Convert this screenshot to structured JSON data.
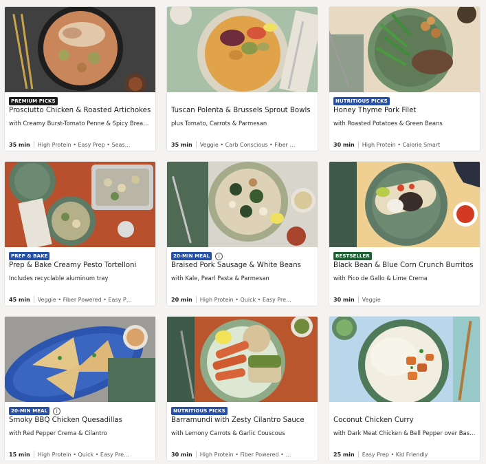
{
  "colors": {
    "badge_dark": "#1c1c1c",
    "badge_blue": "#2650a8",
    "badge_green": "#1f5f34"
  },
  "recipes": [
    {
      "badge": "PREMIUM PICKS",
      "badge_color": "#1c1c1c",
      "info_icon": false,
      "title": "Prosciutto Chicken & Roasted Artichokes",
      "subtitle": "with Creamy Burst-Tomato Penne & Spicy Breadcru…",
      "time": "35 min",
      "tags": "High Protein • Easy Prep • Seas…",
      "photo": "pasta-chicken-dark"
    },
    {
      "badge": "",
      "badge_color": "",
      "info_icon": false,
      "title": "Tuscan Polenta & Brussels Sprout Bowls",
      "subtitle": "plus Tomato, Carrots & Parmesan",
      "time": "35 min",
      "tags": "Veggie • Carb Conscious • Fiber …",
      "photo": "polenta-bowl-green"
    },
    {
      "badge": "NUTRITIOUS PICKS",
      "badge_color": "#2650a8",
      "info_icon": false,
      "title": "Honey Thyme Pork Filet",
      "subtitle": "with Roasted Potatoes & Green Beans",
      "time": "30 min",
      "tags": "High Protein • Calorie Smart",
      "photo": "pork-green-beans"
    },
    {
      "badge": "PREP & BAKE",
      "badge_color": "#2650a8",
      "info_icon": false,
      "title": "Prep & Bake Creamy Pesto Tortelloni",
      "subtitle": "Includes recyclable aluminum tray",
      "time": "45 min",
      "tags": "Veggie • Fiber Powered • Easy P…",
      "photo": "pesto-tortelloni-tray"
    },
    {
      "badge": "20-MIN MEAL",
      "badge_color": "#2650a8",
      "info_icon": true,
      "title": "Braised Pork Sausage & White Beans",
      "subtitle": "with Kale, Pearl Pasta & Parmesan",
      "time": "20 min",
      "tags": "High Protein • Quick • Easy Pre…",
      "photo": "sausage-white-beans"
    },
    {
      "badge": "BESTSELLER",
      "badge_color": "#1f5f34",
      "info_icon": false,
      "title": "Black Bean & Blue Corn Crunch Burritos",
      "subtitle": "with Pico de Gallo & Lime Crema",
      "time": "30 min",
      "tags": "Veggie",
      "photo": "burritos-salsa"
    },
    {
      "badge": "20-MIN MEAL",
      "badge_color": "#2650a8",
      "info_icon": true,
      "title": "Smoky BBQ Chicken Quesadillas",
      "subtitle": "with Red Pepper Crema & Cilantro",
      "time": "15 min",
      "tags": "High Protein • Quick • Easy Pre…",
      "photo": "quesadillas-blue-plate"
    },
    {
      "badge": "NUTRITIOUS PICKS",
      "badge_color": "#2650a8",
      "info_icon": false,
      "title": "Barramundi with Zesty Cilantro Sauce",
      "subtitle": "with Lemony Carrots & Garlic Couscous",
      "time": "30 min",
      "tags": "High Protein • Fiber Powered • …",
      "photo": "barramundi-couscous"
    },
    {
      "badge": "",
      "badge_color": "",
      "info_icon": false,
      "title": "Coconut Chicken Curry",
      "subtitle": "with Dark Meat Chicken & Bell Pepper over Basmati…",
      "time": "25 min",
      "tags": "Easy Prep • Kid Friendly",
      "photo": "chicken-curry-rice"
    }
  ]
}
